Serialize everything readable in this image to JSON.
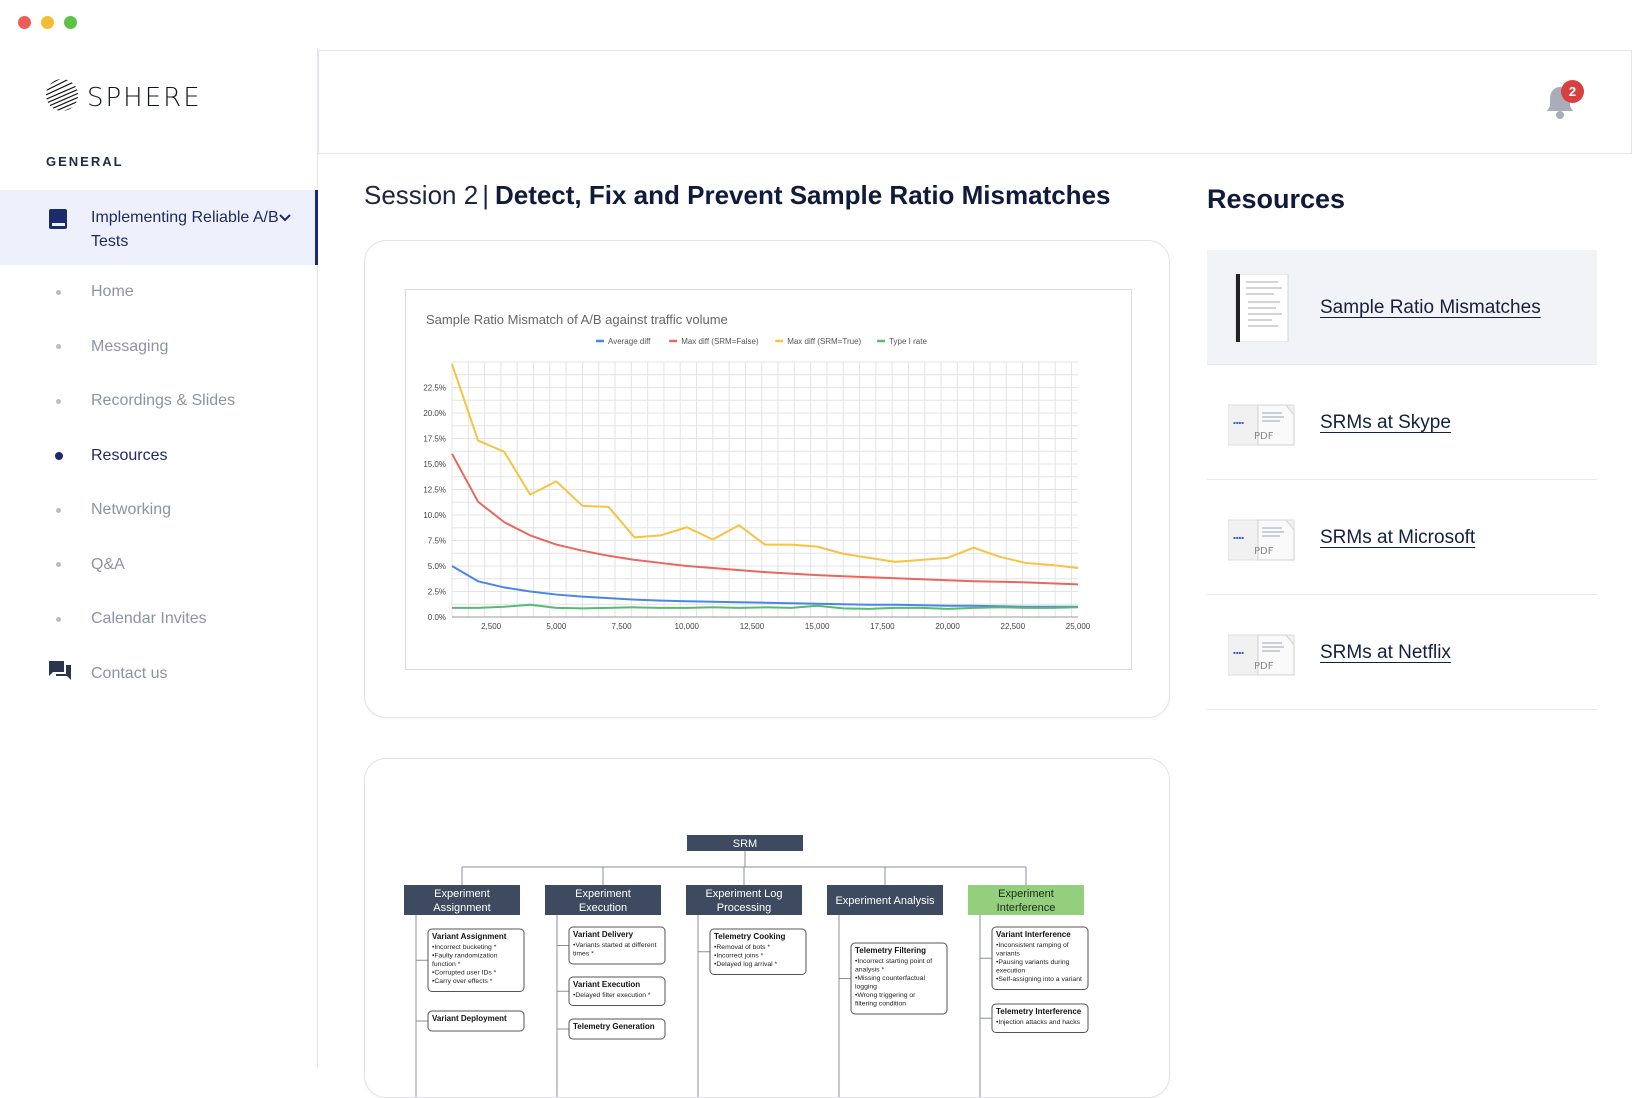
{
  "brand": {
    "name": "SPHERE"
  },
  "sidebar": {
    "section_label": "GENERAL",
    "active_group": "Implementing Reliable A/B Tests",
    "items": [
      {
        "label": "Home"
      },
      {
        "label": "Messaging"
      },
      {
        "label": "Recordings & Slides"
      },
      {
        "label": "Resources",
        "current": true
      },
      {
        "label": "Networking"
      },
      {
        "label": "Q&A"
      },
      {
        "label": "Calendar Invites"
      },
      {
        "label": "Contact us"
      }
    ]
  },
  "header": {
    "notification_count": "2"
  },
  "page": {
    "session": "Session 2",
    "separator": "|",
    "title": "Detect, Fix and Prevent Sample Ratio Mismatches"
  },
  "chart_data": {
    "type": "line",
    "title": "Sample Ratio Mismatch of A/B against traffic volume",
    "xlabel": "",
    "ylabel": "",
    "x": [
      1000,
      2000,
      3000,
      4000,
      5000,
      6000,
      7000,
      8000,
      9000,
      10000,
      11000,
      12000,
      13000,
      14000,
      15000,
      16000,
      17000,
      18000,
      19000,
      20000,
      21000,
      22000,
      23000,
      24000,
      25000
    ],
    "x_ticks": [
      "2,500",
      "5,000",
      "7,500",
      "10,000",
      "12,500",
      "15,000",
      "17,500",
      "20,000",
      "22,500",
      "25,000"
    ],
    "y_ticks": [
      "0.0%",
      "2.5%",
      "5.0%",
      "7.5%",
      "10.0%",
      "12.5%",
      "15.0%",
      "17.5%",
      "20.0%",
      "22.5%"
    ],
    "ylim": [
      0,
      25
    ],
    "grid": true,
    "legend_position": "top",
    "series": [
      {
        "name": "Average diff",
        "color": "#4a86e8",
        "values": [
          5.0,
          3.5,
          2.9,
          2.5,
          2.2,
          2.0,
          1.85,
          1.7,
          1.6,
          1.55,
          1.5,
          1.45,
          1.4,
          1.35,
          1.3,
          1.25,
          1.2,
          1.2,
          1.15,
          1.1,
          1.1,
          1.05,
          1.0,
          1.0,
          1.0
        ]
      },
      {
        "name": "Max diff (SRM=False)",
        "color": "#e8675f",
        "values": [
          16.0,
          11.3,
          9.3,
          8.0,
          7.1,
          6.5,
          6.0,
          5.6,
          5.3,
          5.0,
          4.8,
          4.6,
          4.4,
          4.25,
          4.1,
          4.0,
          3.9,
          3.8,
          3.7,
          3.6,
          3.5,
          3.45,
          3.4,
          3.3,
          3.2
        ]
      },
      {
        "name": "Max diff (SRM=True)",
        "color": "#f6c342",
        "values": [
          24.8,
          17.3,
          16.2,
          12.0,
          13.3,
          10.9,
          10.8,
          7.8,
          8.0,
          8.8,
          7.6,
          9.0,
          7.1,
          7.1,
          6.9,
          6.2,
          5.8,
          5.4,
          5.6,
          5.8,
          6.8,
          5.9,
          5.3,
          5.1,
          4.8
        ]
      },
      {
        "name": "Type I rate",
        "color": "#57bb70",
        "values": [
          0.9,
          0.9,
          1.0,
          1.2,
          0.9,
          0.85,
          0.9,
          0.95,
          0.9,
          0.9,
          0.95,
          0.9,
          0.95,
          0.9,
          1.1,
          0.85,
          0.8,
          0.9,
          0.9,
          0.8,
          0.9,
          0.95,
          0.9,
          0.9,
          0.95
        ]
      }
    ]
  },
  "diagram": {
    "root": "SRM",
    "columns": [
      {
        "title": "Experiment Assignment",
        "highlight": false,
        "boxes": [
          {
            "heading": "Variant Assignment",
            "lines": [
              "•Incorrect bucketing *",
              "•Faulty randomization",
              " function *",
              "•Corrupted user IDs *",
              "•Carry over effects *"
            ]
          },
          {
            "heading": "Variant Deployment",
            "lines": []
          }
        ]
      },
      {
        "title": "Experiment Execution",
        "highlight": false,
        "boxes": [
          {
            "heading": "Variant Delivery",
            "lines": [
              "•Variants started at different",
              " times *"
            ]
          },
          {
            "heading": "Variant Execution",
            "lines": [
              "•Delayed filter execution *"
            ]
          },
          {
            "heading": "Telemetry Generation",
            "lines": []
          }
        ]
      },
      {
        "title": "Experiment Log Processing",
        "highlight": false,
        "boxes": [
          {
            "heading": "Telemetry Cooking",
            "lines": [
              "•Removal of bots *",
              "•Incorrect joins *",
              "•Delayed log arrival *"
            ]
          }
        ]
      },
      {
        "title": "Experiment Analysis",
        "highlight": false,
        "boxes": [
          {
            "heading": "Telemetry Filtering",
            "lines": [
              "•Incorrect starting point of",
              " analysis *",
              "•Missing counterfactual",
              " logging",
              "•Wrong triggering or",
              " filtering condition"
            ]
          }
        ]
      },
      {
        "title": "Experiment Interference",
        "highlight": true,
        "boxes": [
          {
            "heading": "Variant Interference",
            "lines": [
              "•Inconsistent ramping of",
              " variants",
              "•Pausing variants during",
              " execution",
              "•Self-assigning into a variant"
            ]
          },
          {
            "heading": "Telemetry Interference",
            "lines": [
              "•Injection attacks and hacks"
            ]
          }
        ]
      }
    ]
  },
  "resources": {
    "title": "Resources",
    "items": [
      {
        "label": "Sample Ratio Mismatches",
        "thumb": "document"
      },
      {
        "label": "SRMs at Skype",
        "thumb": "pdf",
        "thumb_text": "PDF"
      },
      {
        "label": "SRMs at Microsoft",
        "thumb": "pdf",
        "thumb_text": "PDF"
      },
      {
        "label": "SRMs at Netflix",
        "thumb": "pdf",
        "thumb_text": "PDF"
      }
    ]
  },
  "colors": {
    "accent": "#1c2b6b",
    "active_bg": "#eef0fb",
    "badge": "#d7403e",
    "diagram_header": "#3e4a5f",
    "diagram_highlight": "#93cf7c"
  }
}
